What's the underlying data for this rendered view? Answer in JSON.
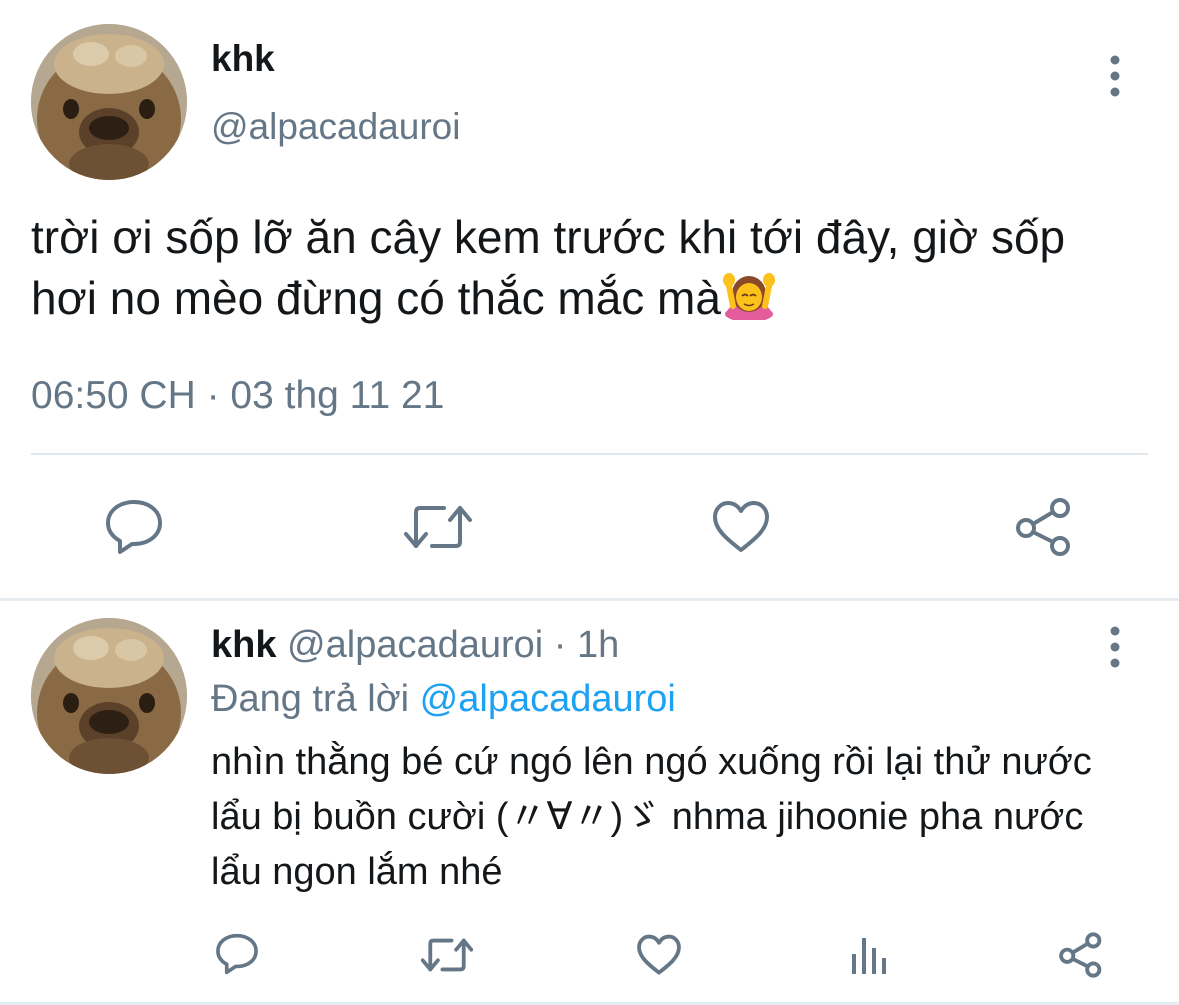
{
  "main_tweet": {
    "author_name": "khk",
    "author_handle": "@alpacadauroi",
    "text": "trời ơi sốp lỡ ăn cây kem trước khi tới đây, giờ sốp hơi no mèo đừng có thắc mắc mà",
    "emoji": "woman-getting-massage-emoji",
    "timestamp": "06:50 CH · 03 thg 11 21",
    "actions": [
      "reply-icon",
      "retweet-icon",
      "like-icon",
      "share-icon"
    ]
  },
  "reply_tweet": {
    "author_name": "khk",
    "author_handle": "@alpacadauroi",
    "separator": " · ",
    "time": "1h",
    "replying_prefix": "Đang trả lời ",
    "replying_to": "@alpacadauroi",
    "text": "nhìn thằng bé cứ ngó lên ngó xuống rồi lại thử nước lẩu bị buồn cười (〃∀〃)ゞ nhma jihoonie pha nước lẩu ngon lắm nhé",
    "actions": [
      "reply-icon",
      "retweet-icon",
      "like-icon",
      "analytics-icon",
      "share-icon"
    ]
  },
  "colors": {
    "text_primary": "#14171a",
    "text_secondary": "#657786",
    "icon": "#657786",
    "link": "#1da1f2",
    "divider": "#e1e8ed"
  }
}
